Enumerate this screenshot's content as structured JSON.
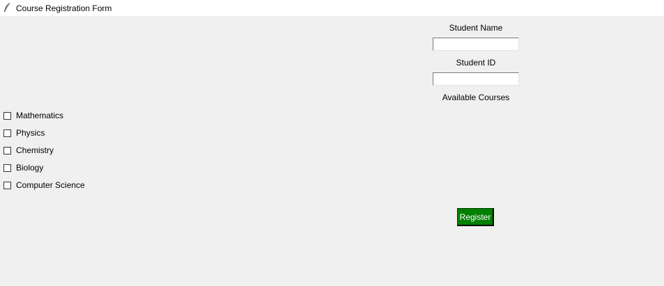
{
  "window": {
    "title": "Course Registration Form",
    "icon": "feather-icon"
  },
  "form": {
    "student_name_label": "Student Name",
    "student_name_value": "",
    "student_id_label": "Student ID",
    "student_id_value": "",
    "available_courses_label": "Available Courses"
  },
  "courses": [
    {
      "label": "Mathematics",
      "checked": false
    },
    {
      "label": "Physics",
      "checked": false
    },
    {
      "label": "Chemistry",
      "checked": false
    },
    {
      "label": "Biology",
      "checked": false
    },
    {
      "label": "Computer Science",
      "checked": false
    }
  ],
  "register_button": {
    "label": "Register",
    "color": "#008000"
  }
}
